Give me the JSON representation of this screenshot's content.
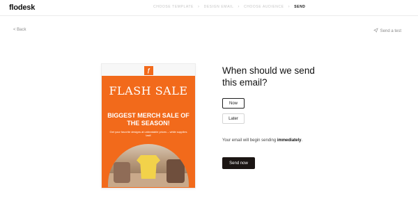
{
  "app": {
    "logo": "flodesk"
  },
  "steps": [
    {
      "label": "CHOOSE TEMPLATE",
      "active": false
    },
    {
      "label": "DESIGN EMAIL",
      "active": false
    },
    {
      "label": "CHOOSE AUDIENCE",
      "active": false
    },
    {
      "label": "SEND",
      "active": true
    }
  ],
  "nav": {
    "back_label": "< Back",
    "send_test_label": "Send a test",
    "send_test_icon": "paper-plane-icon"
  },
  "preview": {
    "brand_icon": "flodesk-f-logo-icon",
    "title": "FLASH SALE",
    "headline": "BIGGEST MERCH SALE OF THE SEASON!",
    "subtext": "Get your favorite designs at unbeatable prices – while supplies last!",
    "accent_color": "#F26A1B"
  },
  "schedule": {
    "question": "When should we send this email?",
    "options": [
      "Now",
      "Later"
    ],
    "selected": "Now",
    "note_prefix": "Your email will begin sending ",
    "note_emphasis": "immediately",
    "note_suffix": ".",
    "send_label": "Send now"
  }
}
